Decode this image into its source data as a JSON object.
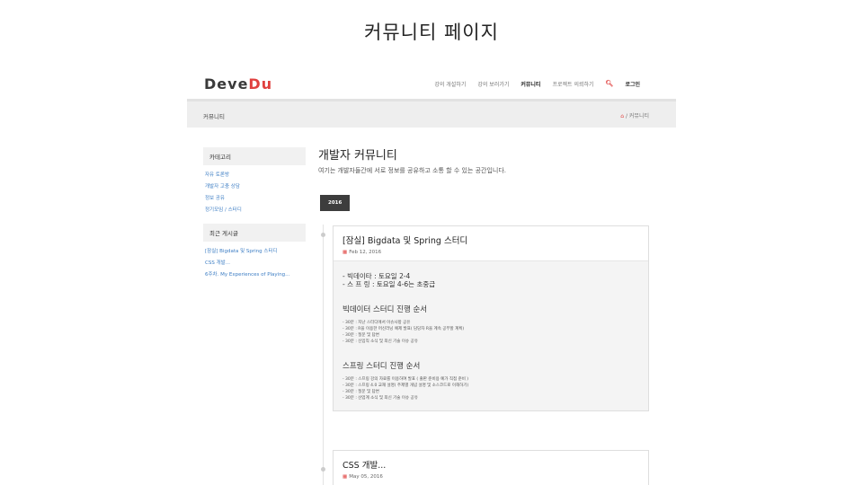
{
  "slide_title": "커뮤니티 페이지",
  "logo": {
    "part1": "Deve",
    "part2": "Du"
  },
  "nav": {
    "items": [
      "강의 개설하기",
      "강의 보러가기",
      "커뮤니티",
      "프로젝트 의뢰하기"
    ],
    "login": "로그인"
  },
  "breadcrumb": {
    "page_name": "커뮤니티",
    "path": "커뮤니티"
  },
  "sidebar": {
    "category_head": "카테고리",
    "categories": [
      "자유 토론방",
      "개발자 고충 상담",
      "정보 공유",
      "정기모임 / 스터디"
    ],
    "recent_head": "최근 게시글",
    "recent": [
      "[잠실] Bigdata 및 Spring 스터디",
      "CSS 개발...",
      "6주차. My Experiences of Playing..."
    ]
  },
  "main": {
    "title": "개발자 커뮤니티",
    "intro": "여기는 개발자들간에 서로 정보를 공유하고 소통 할 수 있는 공간입니다.",
    "year": "2016"
  },
  "posts": [
    {
      "title": "[잠실] Bigdata 및 Spring 스터디",
      "date": "Feb 12, 2016",
      "schedule": [
        "- 빅데이타 : 토요일 2-4",
        "- 스 프 링 : 토요일 4-6는 초중급"
      ],
      "sections": [
        {
          "title": "빅데이터 스터디 진행 순서",
          "lines": [
            "- 30분 : 지난 스터디에서 이슈사항 공유",
            "- 30분 : R을 이용한 머신러닝 예제 발표( 담당자 R을 계속 공부할 계획)",
            "- 30분 : 질문 및 답변",
            "- 30분 : 신입직 소식 및 최신 기술 이슈 공유"
          ]
        },
        {
          "title": "스프링 스터디 진행 순서",
          "lines": [
            "- 30분 : 스프링 강의 자료를 이용하여 발표 ( 출판 준비용 예가 직접 준비 )",
            "- 30분 : 스프링 4.0 교재 설명( 주제별 개념 설명 및 소스코드로 이해하기)",
            "- 30분 : 질문 및 답변",
            "- 30분 : 산업계 소식 및 최신 기술 이슈 공유"
          ]
        }
      ]
    },
    {
      "title": "CSS 개발...",
      "date": "May 05, 2016"
    }
  ],
  "icons": {
    "search": "search-icon",
    "home": "home-icon",
    "calendar": "calendar-icon"
  },
  "colors": {
    "accent": "#e0413f",
    "link": "#3c7dc4",
    "badge": "#3d3d3d"
  }
}
